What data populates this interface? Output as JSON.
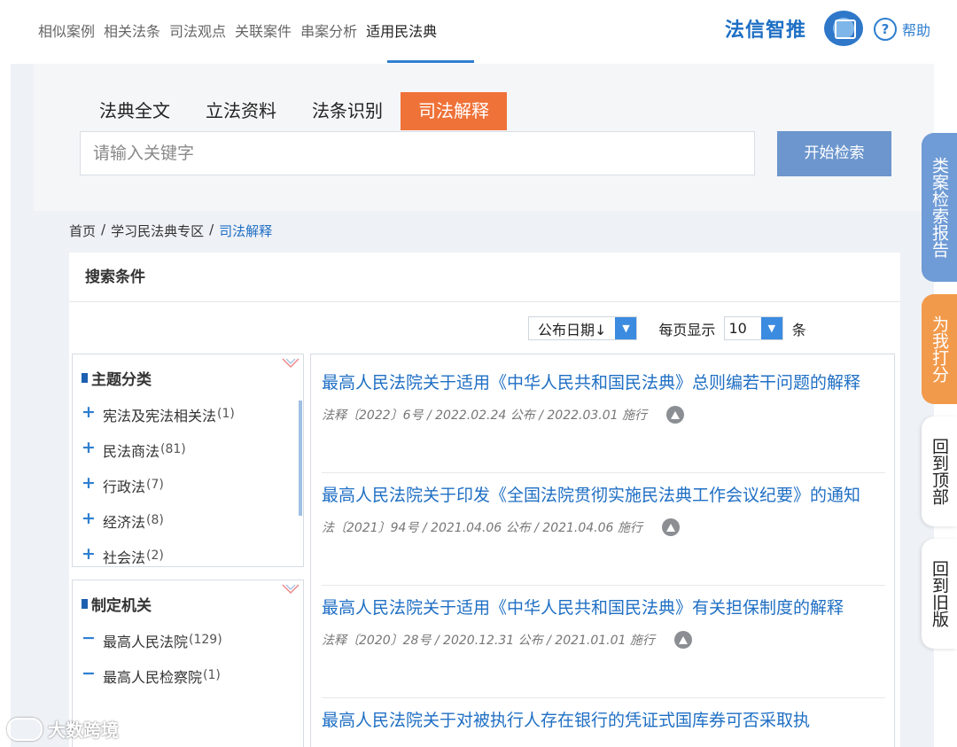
{
  "topnav": {
    "tabs": [
      "相似案例",
      "相关法条",
      "司法观点",
      "关联案件",
      "串案分析",
      "适用民法典"
    ],
    "active_index": 5,
    "brand": "法信智推",
    "help": "帮助"
  },
  "search": {
    "tabs": [
      "法典全文",
      "立法资料",
      "法条识别",
      "司法解释"
    ],
    "active_tab": "司法解释",
    "placeholder": "请输入关键字",
    "button": "开始检索"
  },
  "breadcrumb": [
    "首页",
    "/",
    "学习民法典专区",
    "/",
    "司法解释"
  ],
  "conditions": {
    "title": "搜索条件",
    "sort_value": "公布日期↓",
    "per_page_label": "每页显示",
    "per_page_value": "10",
    "per_page_unit": "条"
  },
  "facets": [
    {
      "title": "主题分类",
      "items": [
        {
          "sign": "+",
          "label": "宪法及宪法相关法",
          "count": "(1)"
        },
        {
          "sign": "+",
          "label": "民法商法",
          "count": "(81)"
        },
        {
          "sign": "+",
          "label": "行政法",
          "count": "(7)"
        },
        {
          "sign": "+",
          "label": "经济法",
          "count": "(8)"
        },
        {
          "sign": "+",
          "label": "社会法",
          "count": "(2)"
        }
      ]
    },
    {
      "title": "制定机关",
      "items": [
        {
          "sign": "−",
          "label": "最高人民法院",
          "count": "(129)"
        },
        {
          "sign": "−",
          "label": "最高人民检察院",
          "count": "(1)"
        }
      ]
    }
  ],
  "results": [
    {
      "title": "最高人民法院关于适用《中华人民共和国民法典》总则编若干问题的解释",
      "meta": "法释〔2022〕6号 / 2022.02.24 公布 / 2022.03.01 施行"
    },
    {
      "title": "最高人民法院关于印发《全国法院贯彻实施民法典工作会议纪要》的通知",
      "meta": "法〔2021〕94号 / 2021.04.06 公布 / 2021.04.06 施行"
    },
    {
      "title": "最高人民法院关于适用《中华人民共和国民法典》有关担保制度的解释",
      "meta": "法释〔2020〕28号 / 2020.12.31 公布 / 2021.01.01 施行"
    },
    {
      "title": "最高人民法院关于对被执行人存在银行的凭证式国库券可否采取执",
      "meta": ""
    }
  ],
  "side_buttons": [
    "类案检索报告",
    "为我打分",
    "回到顶部",
    "回到旧版"
  ],
  "watermark": "大数跨境",
  "colors": {
    "accent": "#1f6fc4",
    "active_tab": "#ef7238",
    "search_button": "#6c96cd"
  }
}
